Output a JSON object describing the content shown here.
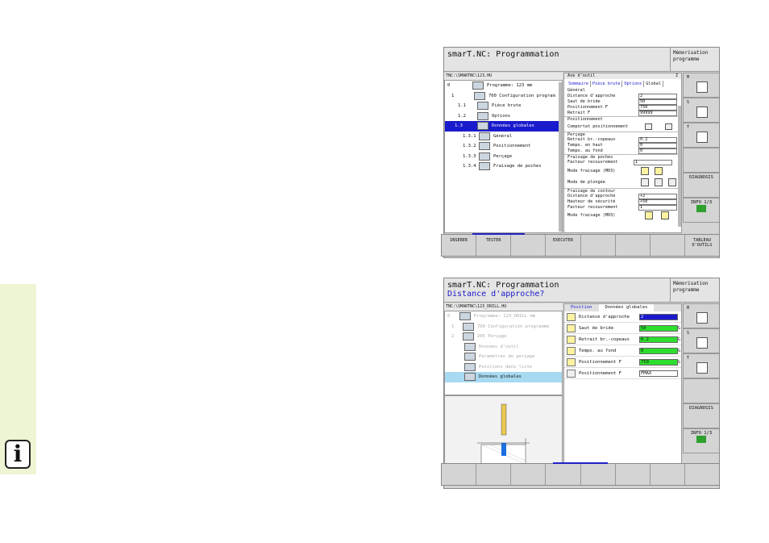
{
  "sidebar": {
    "info_glyph": "i"
  },
  "screen1": {
    "title": "smarT.NC: Programmation",
    "memo": "Mémorisation programme",
    "path": "TNC:\\SMARTNC\\123.HU",
    "tree": [
      {
        "num": "0",
        "label": "Programme: 123 mm"
      },
      {
        "num": "1",
        "label": "700 Configuration program"
      },
      {
        "num": "1.1",
        "label": "Pièce brute"
      },
      {
        "num": "1.2",
        "label": "Options"
      },
      {
        "num": "1.3",
        "label": "Données globales"
      },
      {
        "num": "1.3.1",
        "label": "Général"
      },
      {
        "num": "1.3.2",
        "label": "Positionnement"
      },
      {
        "num": "1.3.3",
        "label": "Perçage"
      },
      {
        "num": "1.3.4",
        "label": "Fraisage de poches"
      }
    ],
    "form": {
      "header_label": "Axe d'outil",
      "header_value": "Z",
      "tabs": [
        "Sommaire",
        "Pièce brute",
        "Options",
        "Global"
      ],
      "general_label": "Général",
      "rows_general": [
        {
          "label": "Distance d'approche",
          "value": "2"
        },
        {
          "label": "Saut de bride",
          "value": "50"
        },
        {
          "label": "Positionnement F",
          "value": "750"
        },
        {
          "label": "Retrait F",
          "value": "99999"
        }
      ],
      "positionnement_label": "Positionnement",
      "comportement_label": "Comportat positionnement",
      "percage_label": "Perçage",
      "rows_percage": [
        {
          "label": "Retrait br.-copeaux",
          "value": "0.2"
        },
        {
          "label": "Tempo. en haut",
          "value": "0"
        },
        {
          "label": "Tempo. au fond",
          "value": "0"
        }
      ],
      "fraisage_label": "Fraisage de poches",
      "facteur_label": "Facteur recouvrement",
      "facteur_value": "1",
      "mode_fraisage_label": "Mode fraisage (M03)",
      "mode_plongee_label": "Mode de plongée",
      "contour_label": "Fraisage de contour",
      "rows_contour": [
        {
          "label": "Distance d'approche",
          "value": "+2"
        },
        {
          "label": "Hauteur de sécurité",
          "value": "+50"
        },
        {
          "label": "Facteur recouvrement",
          "value": "1"
        }
      ],
      "mode_fraisage2_label": "Mode fraisage (M03)"
    },
    "vkeys": [
      {
        "letter": "M",
        "label": ""
      },
      {
        "letter": "S",
        "label": ""
      },
      {
        "letter": "T",
        "label": ""
      },
      {
        "letter": "",
        "label": ""
      },
      {
        "letter": "",
        "label": "DIAGNOSIS"
      },
      {
        "letter": "",
        "label": "INFO 1/3"
      }
    ],
    "softkeys": [
      "INSERER",
      "TESTER",
      "",
      "EXECUTER",
      "",
      "",
      "",
      "TABLEAU D'OUTILS"
    ]
  },
  "screen2": {
    "title": "smarT.NC: Programmation",
    "subtitle": "Distance d'approche?",
    "memo": "Mémorisation programme",
    "path": "TNC:\\SMARTNC\\123_DRILL.HU",
    "tree": [
      {
        "num": "0",
        "label": "Programme: 123_DRILL mm"
      },
      {
        "num": "1",
        "label": "700 Configuration programme"
      },
      {
        "num": "2",
        "label": "205 Perçage"
      },
      {
        "num": "",
        "label": "Données d'outil"
      },
      {
        "num": "",
        "label": "Paramètres de perçage"
      },
      {
        "num": "",
        "label": "Positions dans liste"
      },
      {
        "num": "",
        "label": "Données globales"
      }
    ],
    "tabs": [
      "Position",
      "Données globales"
    ],
    "rows": [
      {
        "label": "Distance d'approche",
        "value": "2",
        "g": ""
      },
      {
        "label": "Saut de bride",
        "value": "50",
        "g": "G"
      },
      {
        "label": "Retrait br.-copeaux",
        "value": "0.2",
        "g": "G"
      },
      {
        "label": "Tempo. au fond",
        "value": "0",
        "g": "G"
      },
      {
        "label": "Positionnement F",
        "value": "750",
        "g": "G"
      },
      {
        "label": "Positionnement F",
        "value": "FMAX",
        "g": ""
      }
    ],
    "vkeys": [
      {
        "letter": "M",
        "label": ""
      },
      {
        "letter": "S",
        "label": ""
      },
      {
        "letter": "T",
        "label": ""
      },
      {
        "letter": "",
        "label": ""
      },
      {
        "letter": "",
        "label": "DIAGNOSIS"
      },
      {
        "letter": "",
        "label": "INFO 1/3"
      }
    ]
  },
  "colors": {
    "accent": "#1a1acd",
    "selected_light": "#a7daf0",
    "green": "#2ede2e",
    "sidebar": "#eef5d4"
  }
}
